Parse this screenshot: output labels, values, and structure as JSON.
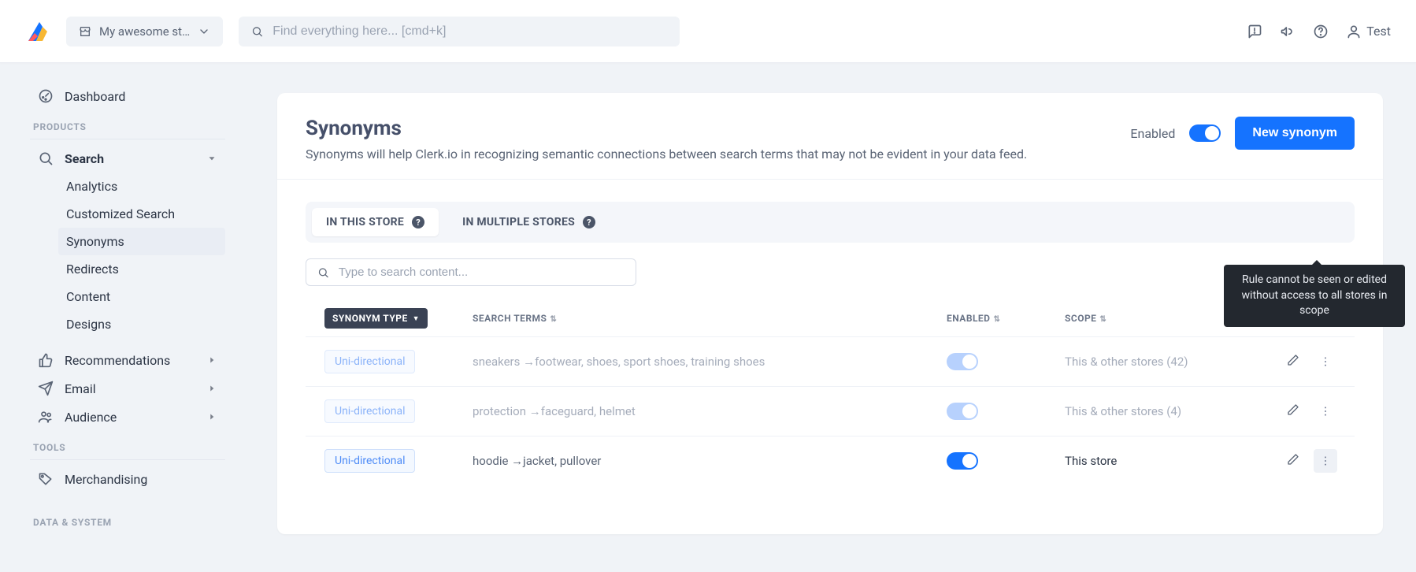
{
  "header": {
    "store_name": "My awesome st…",
    "search_placeholder": "Find everything here... [cmd+k]",
    "user_name": "Test"
  },
  "sidebar": {
    "dashboard": "Dashboard",
    "sections": {
      "products": "PRODUCTS",
      "tools": "TOOLS",
      "data_system": "DATA & SYSTEM"
    },
    "search": {
      "label": "Search",
      "items": [
        "Analytics",
        "Customized Search",
        "Synonyms",
        "Redirects",
        "Content",
        "Designs"
      ],
      "active_index": 2
    },
    "recommendations": "Recommendations",
    "email": "Email",
    "audience": "Audience",
    "merchandising": "Merchandising"
  },
  "page": {
    "title": "Synonyms",
    "subtitle": "Synonyms will help Clerk.io in recognizing semantic connections between search terms that may not be evident in your data feed.",
    "enabled_label": "Enabled",
    "new_button": "New synonym"
  },
  "tabs": {
    "in_store": "IN THIS STORE",
    "multi_store": "IN MULTIPLE STORES"
  },
  "content_search_placeholder": "Type to search content...",
  "table": {
    "headers": {
      "type": "SYNONYM TYPE",
      "terms": "SEARCH TERMS",
      "enabled": "ENABLED",
      "scope": "SCOPE"
    },
    "rows": [
      {
        "type": "Uni-directional",
        "terms": "sneakers →footwear, shoes, sport shoes, training shoes",
        "scope": "This & other stores (42)",
        "muted": true
      },
      {
        "type": "Uni-directional",
        "terms": "protection →faceguard, helmet",
        "scope": "This & other stores (4)",
        "muted": true
      },
      {
        "type": "Uni-directional",
        "terms": "hoodie →jacket, pullover",
        "scope": "This store",
        "muted": false
      }
    ]
  },
  "tooltip": "Rule cannot be seen or edited without access to all stores in scope"
}
